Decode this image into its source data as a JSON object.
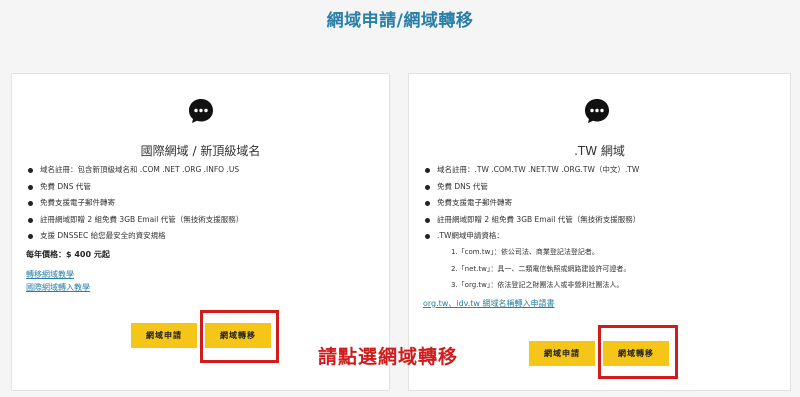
{
  "page_title": "網域申請/網域轉移",
  "instruction": "請點選網域轉移",
  "cards": {
    "international": {
      "icon": "chat-bubble-icon",
      "title": "國際網域 / 新頂級域名",
      "features": [
        "域名註冊：包含新頂級域名和 .COM .NET .ORG .INFO .US",
        "免費 DNS 代管",
        "免費支援電子郵件轉寄",
        "註冊網域即贈 2 組免費 3GB Email 代管（無技術支援服務）",
        "支援 DNSSEC 給您最安全的資安規格"
      ],
      "price": "每年價格：$ 400 元起",
      "links": [
        "轉移網域教學",
        "國際網域轉入教學"
      ],
      "apply_button": "網域申請",
      "transfer_button": "網域轉移"
    },
    "tw": {
      "icon": "chat-bubble-icon",
      "title": ".TW 網域",
      "features": [
        "域名註冊：.TW .COM.TW .NET.TW .ORG.TW（中文）.TW",
        "免費 DNS 代管",
        "免費支援電子郵件轉寄",
        "註冊網域即贈 2 組免費 3GB Email 代管（無技術支援服務）",
        ".TW網域申請資格："
      ],
      "qualifications": [
        "1.「com.tw」：依公司法、商業登記法登記者。",
        "2.「net.tw」：具一、二類電信執照或網路建設許可證者。",
        "3.「org.tw」：依法登記之財團法人或非營利社團法人。"
      ],
      "link": "org.tw、idv.tw 網域名稱轉入申請書",
      "apply_button": "網域申請",
      "transfer_button": "網域轉移"
    }
  },
  "colors": {
    "title_blue": "#2a7fa8",
    "button_yellow": "#f5c518",
    "highlight_red": "#d01c1c"
  }
}
